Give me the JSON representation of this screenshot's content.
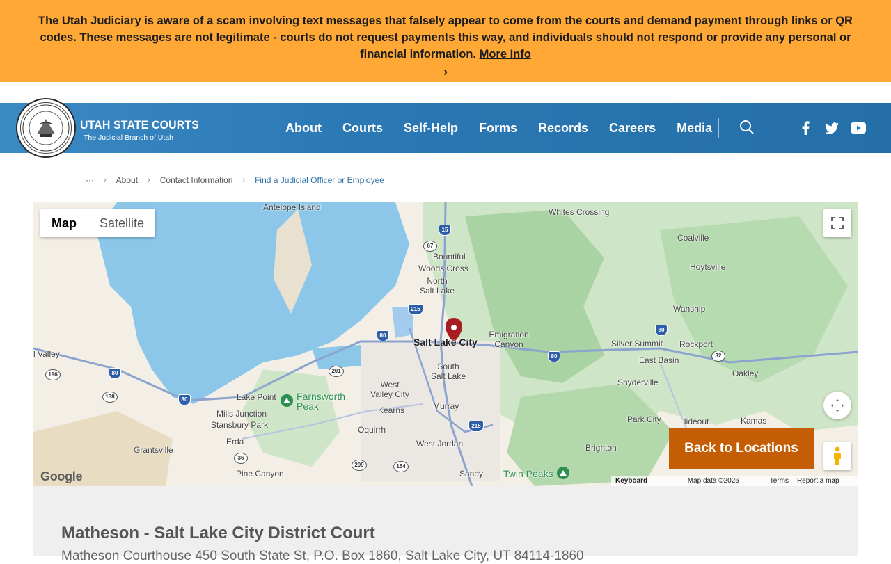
{
  "alert": {
    "message": "The Utah Judiciary is aware of a scam involving text messages that falsely appear to come from the courts and demand payment through links or QR codes. These messages are not legitimate - courts do not request payments this way, and individuals should not respond or provide any personal or financial information.",
    "link_label": "More Info",
    "chevron": "›",
    "color": "#ffa836"
  },
  "header": {
    "brand_title": "UTAH STATE COURTS",
    "brand_subtitle": "The Judicial Branch of Utah",
    "seal_text": "STATE OF UTAH · JUDICIARY",
    "nav": [
      "About",
      "Courts",
      "Self-Help",
      "Forms",
      "Records",
      "Careers",
      "Media"
    ],
    "icons": [
      "search-icon",
      "facebook-icon",
      "twitter-icon",
      "youtube-icon"
    ],
    "color": "#2a78b4"
  },
  "breadcrumb": {
    "ellipsis": "···",
    "items": [
      "About",
      "Contact Information"
    ],
    "current": "Find a Judicial Officer or Employee"
  },
  "map": {
    "type_buttons": [
      "Map",
      "Satellite"
    ],
    "selected_type": "Map",
    "back_button": "Back to Locations",
    "google_logo": "Google",
    "attribution": [
      "Keyboard shortcuts",
      "Map data ©2026 Google",
      "Terms",
      "Report a map error"
    ],
    "places": {
      "antelope": "Antelope Island",
      "whites": "Whites Crossing",
      "coalville": "Coalville",
      "bountiful": "Bountiful",
      "woods": "Woods Cross",
      "nsl": "North Salt Lake",
      "hoytsville": "Hoytsville",
      "wanship": "Wanship",
      "slc": "Salt Lake City",
      "emigration": "Emigration Canyon",
      "silver": "Silver Summit",
      "rockport": "Rockport",
      "eastbasin": "East Basin",
      "valley": "l Valley",
      "ssl": "South Salt Lake",
      "wvc": "West Valley City",
      "snyderville": "Snyderville",
      "oakley": "Oakley",
      "lakepoint": "Lake Point",
      "farnsworth": "Farnsworth Peak",
      "kearns": "Kearns",
      "murray": "Murray",
      "parkcity": "Park City",
      "hideout": "Hideout",
      "kamas": "Kamas",
      "mills": "Mills Junction",
      "stansbury": "Stansbury Park",
      "oquirrh": "Oquirrh",
      "westjordan": "West Jordan",
      "brighton": "Brighton",
      "erda": "Erda",
      "grantsville": "Grantsville",
      "pinecanyon": "Pine Canyon",
      "sandy": "Sandy",
      "twinpeaks": "Twin Peaks"
    },
    "route_shields": [
      "15",
      "67",
      "215",
      "80",
      "80",
      "80",
      "80",
      "201",
      "196",
      "80",
      "138",
      "80",
      "215",
      "36",
      "209",
      "154",
      "32"
    ]
  },
  "location": {
    "name": "Matheson - Salt Lake City District Court",
    "address": "Matheson Courthouse 450 South State St, P.O. Box 1860, Salt Lake City, UT 84114-1860"
  }
}
